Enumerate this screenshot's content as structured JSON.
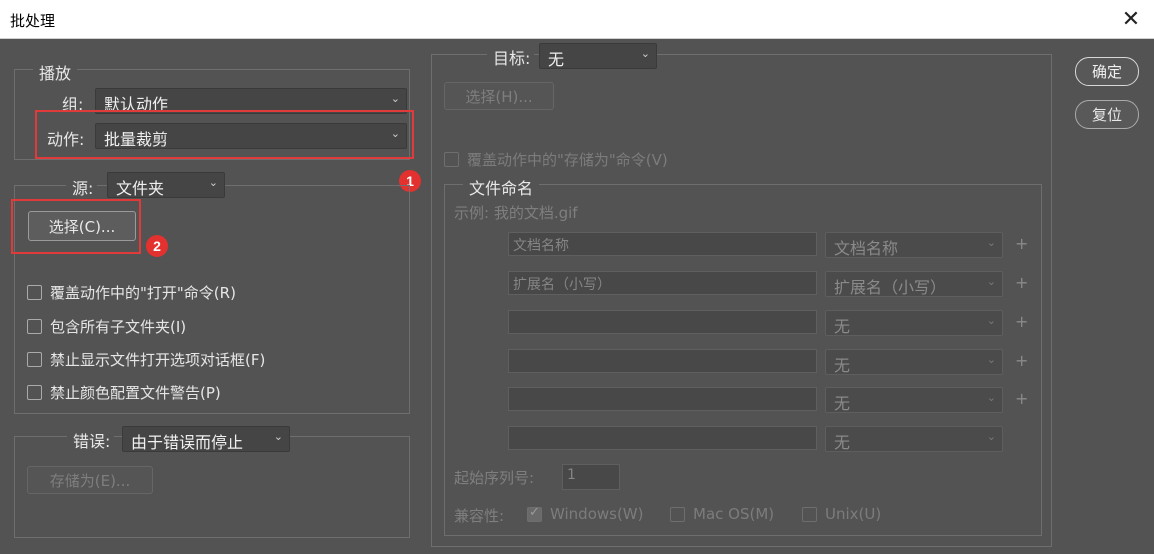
{
  "window": {
    "title": "批处理",
    "close_glyph": "✕"
  },
  "play": {
    "legend": "播放",
    "group_label": "组:",
    "group_value": "默认动作",
    "action_label": "动作:",
    "action_value": "批量裁剪"
  },
  "source": {
    "label": "源:",
    "value": "文件夹",
    "choose_button": "选择(C)...",
    "options": [
      "覆盖动作中的\"打开\"命令(R)",
      "包含所有子文件夹(I)",
      "禁止显示文件打开选项对话框(F)",
      "禁止颜色配置文件警告(P)"
    ]
  },
  "error": {
    "label": "错误:",
    "value": "由于错误而停止",
    "save_button": "存储为(E)..."
  },
  "target": {
    "label": "目标:",
    "value": "无",
    "choose_button": "选择(H)...",
    "override_save": "覆盖动作中的\"存储为\"命令(V)"
  },
  "naming": {
    "legend": "文件命名",
    "example": "示例: 我的文档.gif",
    "rows": [
      {
        "text": "文档名称",
        "select": "文档名称",
        "plus": "+"
      },
      {
        "text": "扩展名（小写）",
        "select": "扩展名（小写）",
        "plus": "+"
      },
      {
        "text": "",
        "select": "无",
        "plus": "+"
      },
      {
        "text": "",
        "select": "无",
        "plus": "+"
      },
      {
        "text": "",
        "select": "无",
        "plus": "+"
      },
      {
        "text": "",
        "select": "无",
        "plus": ""
      }
    ],
    "serial_label": "起始序列号:",
    "serial_value": "1",
    "compat_label": "兼容性:",
    "compat": [
      "Windows(W)",
      "Mac OS(M)",
      "Unix(U)"
    ]
  },
  "buttons": {
    "ok": "确定",
    "reset": "复位"
  },
  "annotations": {
    "badge1": "1",
    "badge2": "2"
  },
  "colors": {
    "background": "#535353",
    "highlight": "#e03a3a"
  }
}
